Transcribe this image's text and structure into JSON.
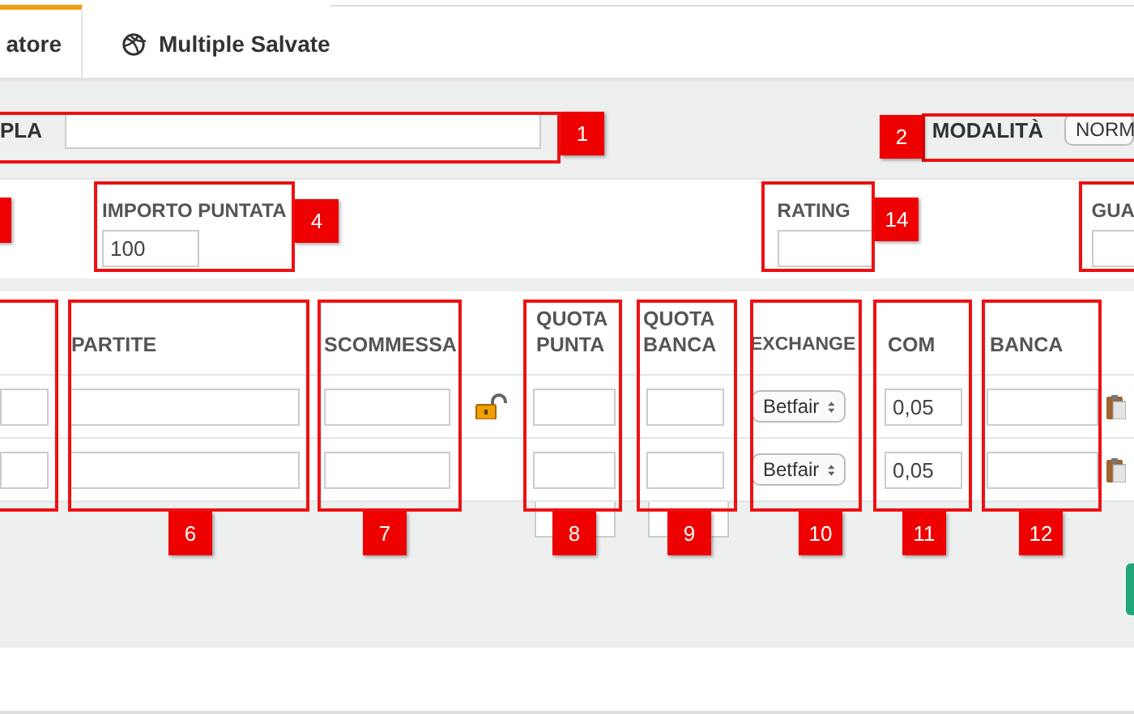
{
  "tabs": [
    {
      "label": "atore",
      "selected": true
    },
    {
      "label": "Multiple Salvate",
      "selected": false
    }
  ],
  "top_row": {
    "label": "PLA",
    "mode_label": "MODALITÀ",
    "mode_value": "NORM"
  },
  "fields": [
    {
      "label": "IMPORTO PUNTATA",
      "value": "100"
    },
    {
      "label": "RATING"
    },
    {
      "label": "GUA"
    }
  ],
  "table": {
    "columns": [
      "PARTITE",
      "SCOMMESSA",
      "QUOTA PUNTA",
      "QUOTA BANCA",
      "EXCHANGE",
      "COM",
      "BANCA"
    ],
    "rows": [
      {
        "locked": false,
        "exchange": "Betfair",
        "com": "0,05"
      },
      {
        "exchange": "Betfair",
        "com": "0,05"
      }
    ]
  },
  "callouts": [
    "1",
    "2",
    "4",
    "14",
    "6",
    "7",
    "8",
    "9",
    "10",
    "11",
    "12"
  ]
}
